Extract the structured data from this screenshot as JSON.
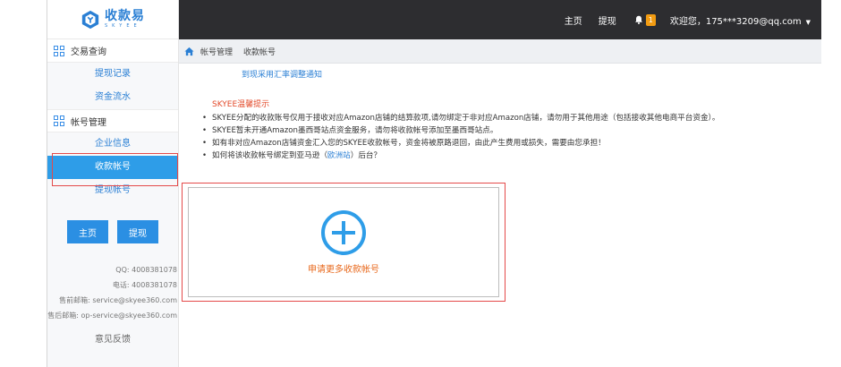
{
  "brand": {
    "name_cn": "收款易",
    "name_en": "SKYEE"
  },
  "topbar": {
    "home": "主页",
    "withdraw": "提现",
    "notification_count": "1",
    "welcome": "欢迎您，175***3209@qq.com"
  },
  "sidebar": {
    "section1": {
      "title": "交易查询",
      "items": [
        "提现记录",
        "资金流水"
      ]
    },
    "section2": {
      "title": "帐号管理",
      "items": [
        "企业信息",
        "收款帐号",
        "提现帐号"
      ]
    },
    "active_item": "收款帐号",
    "buttons": {
      "home": "主页",
      "withdraw": "提现"
    },
    "contact": {
      "qq": "QQ: 4008381078",
      "phone": "电话: 4008381078",
      "presale_email": "售前邮箱: service@skyee360.com",
      "aftersale_email": "售后邮箱: op-service@skyee360.com"
    },
    "feedback": "意见反馈"
  },
  "breadcrumb": {
    "parent": "帐号管理",
    "current": "收款帐号"
  },
  "main": {
    "notice_link": "到现采用汇率调整通知",
    "tips_title": "SKYEE温馨提示",
    "tips": [
      "SKYEE分配的收款账号仅用于接收对应Amazon店铺的结算款项,请勿绑定于非对应Amazon店铺，请勿用于其他用途（包括接收其他电商平台资金）。",
      "SKYEE暂未开通Amazon墨西哥站点资金服务，请勿将收款帐号添加至墨西哥站点。",
      "如有非对应Amazon店铺资金汇入您的SKYEE收款帐号，资金将被原路退回，由此产生费用或损失，需要由您承担！"
    ],
    "tip4_prefix": "如何将该收款帐号绑定到亚马逊（",
    "tip4_link": "欧洲站",
    "tip4_suffix": "）后台？",
    "add_label": "申请更多收款帐号"
  },
  "colors": {
    "accent": "#2e9de8",
    "topbar": "#2d2d30",
    "highlight_border": "#e44a4a",
    "warning": "#e34b2b",
    "add_label": "#e86a1e",
    "badge": "#f39c12"
  }
}
